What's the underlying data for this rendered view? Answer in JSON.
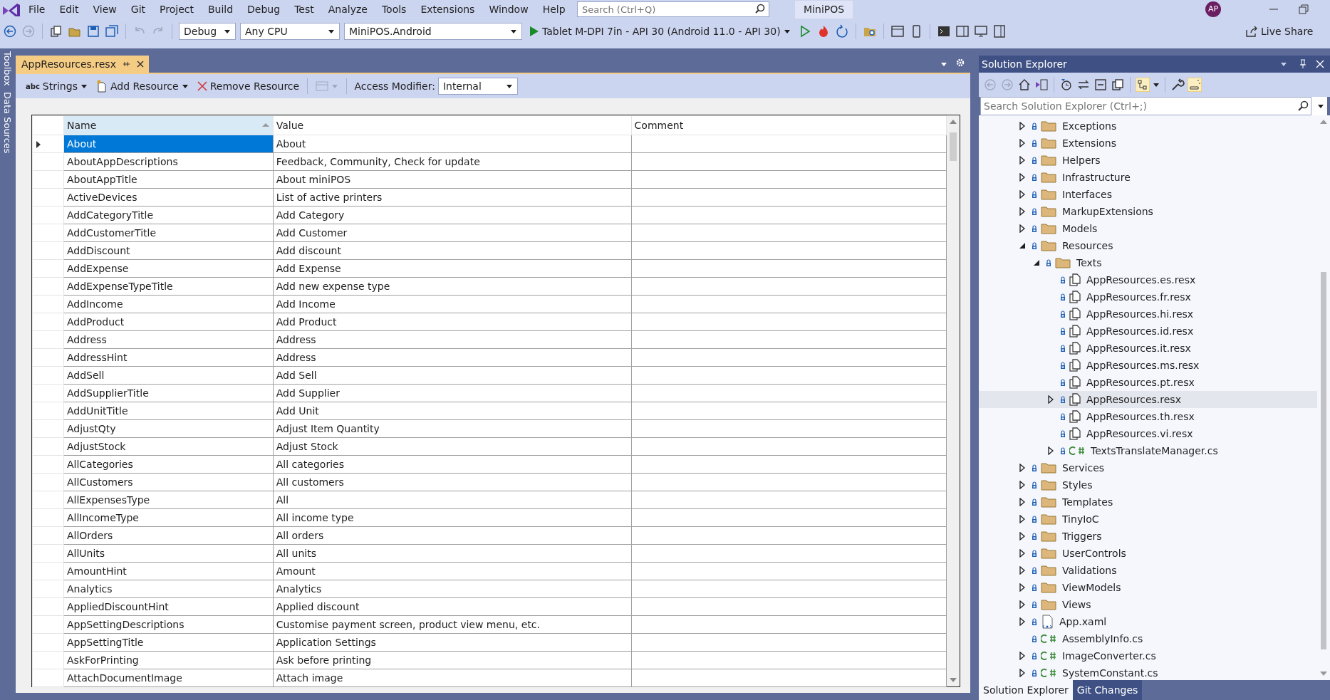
{
  "menu": [
    "File",
    "Edit",
    "View",
    "Git",
    "Project",
    "Build",
    "Debug",
    "Test",
    "Analyze",
    "Tools",
    "Extensions",
    "Window",
    "Help"
  ],
  "search": {
    "placeholder": "Search (Ctrl+Q)"
  },
  "window": {
    "title": "MiniPOS",
    "avatar": "AP"
  },
  "toolbar": {
    "configuration": "Debug",
    "platform": "Any CPU",
    "project": "MiniPOS.Android",
    "run_target": "Tablet M-DPI 7in - API 30 (Android 11.0 - API 30)",
    "live_share": "Live Share"
  },
  "side_tabs": [
    "Toolbox",
    "Data Sources"
  ],
  "document_tab": {
    "title": "AppResources.resx"
  },
  "resource_toolbar": {
    "type_icon": "abc",
    "type": "Strings",
    "add": "Add Resource",
    "remove": "Remove Resource",
    "access_label": "Access Modifier:",
    "access_value": "Internal"
  },
  "table": {
    "columns": [
      "Name",
      "Value",
      "Comment"
    ],
    "rows": [
      {
        "name": "About",
        "value": "About",
        "selected": true
      },
      {
        "name": "AboutAppDescriptions",
        "value": "Feedback, Community, Check for update",
        "selected": false
      },
      {
        "name": "AboutAppTitle",
        "value": "About miniPOS",
        "selected": false
      },
      {
        "name": "ActiveDevices",
        "value": "List of active printers",
        "selected": false
      },
      {
        "name": "AddCategoryTitle",
        "value": "Add Category",
        "selected": false
      },
      {
        "name": "AddCustomerTitle",
        "value": "Add Customer",
        "selected": false
      },
      {
        "name": "AddDiscount",
        "value": "Add discount",
        "selected": false
      },
      {
        "name": "AddExpense",
        "value": "Add Expense",
        "selected": false
      },
      {
        "name": "AddExpenseTypeTitle",
        "value": "Add new expense type",
        "selected": false
      },
      {
        "name": "AddIncome",
        "value": "Add Income",
        "selected": false
      },
      {
        "name": "AddProduct",
        "value": "Add Product",
        "selected": false
      },
      {
        "name": "Address",
        "value": "Address",
        "selected": false
      },
      {
        "name": "AddressHint",
        "value": "Address",
        "selected": false
      },
      {
        "name": "AddSell",
        "value": "Add Sell",
        "selected": false
      },
      {
        "name": "AddSupplierTitle",
        "value": "Add Supplier",
        "selected": false
      },
      {
        "name": "AddUnitTitle",
        "value": "Add Unit",
        "selected": false
      },
      {
        "name": "AdjustQty",
        "value": "Adjust Item Quantity",
        "selected": false
      },
      {
        "name": "AdjustStock",
        "value": "Adjust Stock",
        "selected": false
      },
      {
        "name": "AllCategories",
        "value": "All categories",
        "selected": false
      },
      {
        "name": "AllCustomers",
        "value": "All customers",
        "selected": false
      },
      {
        "name": "AllExpensesType",
        "value": "All",
        "selected": false
      },
      {
        "name": "AllIncomeType",
        "value": "All income type",
        "selected": false
      },
      {
        "name": "AllOrders",
        "value": "All orders",
        "selected": false
      },
      {
        "name": "AllUnits",
        "value": "All units",
        "selected": false
      },
      {
        "name": "AmountHint",
        "value": "Amount",
        "selected": false
      },
      {
        "name": "Analytics",
        "value": "Analytics",
        "selected": false
      },
      {
        "name": "AppliedDiscountHint",
        "value": "Applied discount",
        "selected": false
      },
      {
        "name": "AppSettingDescriptions",
        "value": "Customise payment screen, product view menu, etc.",
        "selected": false
      },
      {
        "name": "AppSettingTitle",
        "value": "Application Settings",
        "selected": false
      },
      {
        "name": "AskForPrinting",
        "value": "Ask before printing",
        "selected": false
      },
      {
        "name": "AttachDocumentImage",
        "value": "Attach image",
        "selected": false
      }
    ]
  },
  "solution_explorer": {
    "title": "Solution Explorer",
    "search": {
      "placeholder": "Search Solution Explorer (Ctrl+;)"
    },
    "items": [
      {
        "label": "Exceptions",
        "kind": "folder",
        "expanded": false,
        "selected": false
      },
      {
        "label": "Extensions",
        "kind": "folder",
        "expanded": false,
        "selected": false
      },
      {
        "label": "Helpers",
        "kind": "folder",
        "expanded": false,
        "selected": false
      },
      {
        "label": "Infrastructure",
        "kind": "folder",
        "expanded": false,
        "selected": false
      },
      {
        "label": "Interfaces",
        "kind": "folder",
        "expanded": false,
        "selected": false
      },
      {
        "label": "MarkupExtensions",
        "kind": "folder",
        "expanded": false,
        "selected": false
      },
      {
        "label": "Models",
        "kind": "folder",
        "expanded": false,
        "selected": false
      },
      {
        "label": "Resources",
        "kind": "folder",
        "expanded": true,
        "selected": false,
        "children": [
          {
            "label": "Texts",
            "kind": "folder",
            "expanded": true,
            "selected": false,
            "children": [
              {
                "label": "AppResources.es.resx",
                "kind": "resx",
                "selected": false
              },
              {
                "label": "AppResources.fr.resx",
                "kind": "resx",
                "selected": false
              },
              {
                "label": "AppResources.hi.resx",
                "kind": "resx",
                "selected": false
              },
              {
                "label": "AppResources.id.resx",
                "kind": "resx",
                "selected": false
              },
              {
                "label": "AppResources.it.resx",
                "kind": "resx",
                "selected": false
              },
              {
                "label": "AppResources.ms.resx",
                "kind": "resx",
                "selected": false
              },
              {
                "label": "AppResources.pt.resx",
                "kind": "resx",
                "selected": false
              },
              {
                "label": "AppResources.resx",
                "kind": "resx",
                "expanded": false,
                "selected": true
              },
              {
                "label": "AppResources.th.resx",
                "kind": "resx",
                "selected": false
              },
              {
                "label": "AppResources.vi.resx",
                "kind": "resx",
                "selected": false
              },
              {
                "label": "TextsTranslateManager.cs",
                "kind": "cs",
                "expanded": false,
                "selected": false
              }
            ]
          }
        ]
      },
      {
        "label": "Services",
        "kind": "folder",
        "expanded": false,
        "selected": false
      },
      {
        "label": "Styles",
        "kind": "folder",
        "expanded": false,
        "selected": false
      },
      {
        "label": "Templates",
        "kind": "folder",
        "expanded": false,
        "selected": false
      },
      {
        "label": "TinyIoC",
        "kind": "folder",
        "expanded": false,
        "selected": false
      },
      {
        "label": "Triggers",
        "kind": "folder",
        "expanded": false,
        "selected": false
      },
      {
        "label": "UserControls",
        "kind": "folder",
        "expanded": false,
        "selected": false
      },
      {
        "label": "Validations",
        "kind": "folder",
        "expanded": false,
        "selected": false
      },
      {
        "label": "ViewModels",
        "kind": "folder",
        "expanded": false,
        "selected": false
      },
      {
        "label": "Views",
        "kind": "folder",
        "expanded": false,
        "selected": false
      },
      {
        "label": "App.xaml",
        "kind": "xaml",
        "expanded": false,
        "selected": false
      },
      {
        "label": "AssemblyInfo.cs",
        "kind": "cs",
        "selected": false
      },
      {
        "label": "ImageConverter.cs",
        "kind": "cs",
        "expanded": false,
        "selected": false
      },
      {
        "label": "SystemConstant.cs",
        "kind": "cs",
        "expanded": false,
        "selected": false
      }
    ]
  },
  "bottom_tabs": [
    {
      "label": "Solution Explorer",
      "selected": true
    },
    {
      "label": "Git Changes",
      "selected": false
    }
  ]
}
